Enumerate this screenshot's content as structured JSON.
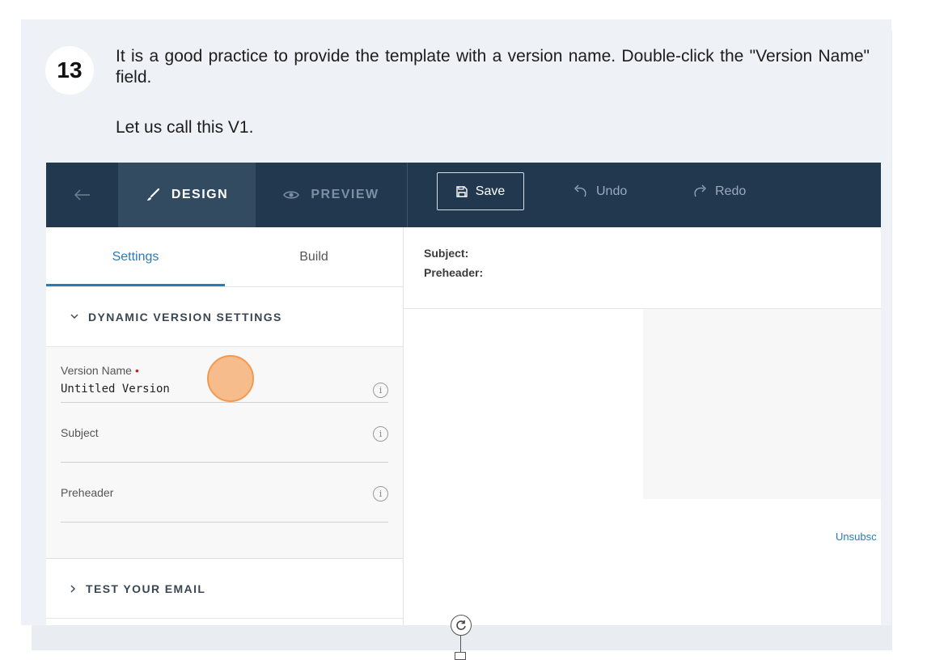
{
  "step": {
    "number": "13",
    "text": "It is a good practice to provide the template with a version name. Double-click the \"Version Name\" field.",
    "subtext": "Let us call this V1."
  },
  "toolbar": {
    "design_label": "DESIGN",
    "preview_label": "PREVIEW",
    "save_label": "Save",
    "undo_label": "Undo",
    "redo_label": "Redo"
  },
  "tabs": {
    "settings": "Settings",
    "build": "Build"
  },
  "sections": {
    "dynamic_version": "DYNAMIC VERSION SETTINGS",
    "test_email": "TEST YOUR EMAIL"
  },
  "fields": {
    "version_name_label": "Version Name",
    "version_name_value": "Untitled Version",
    "subject_label": "Subject",
    "preheader_label": "Preheader"
  },
  "preview": {
    "subject_label": "Subject:",
    "preheader_label": "Preheader:",
    "unsubscribe_text": "Unsubsc"
  },
  "colors": {
    "topbar": "#22384e",
    "accent": "#2a7bb3",
    "click_indicator": "#f6b278"
  }
}
